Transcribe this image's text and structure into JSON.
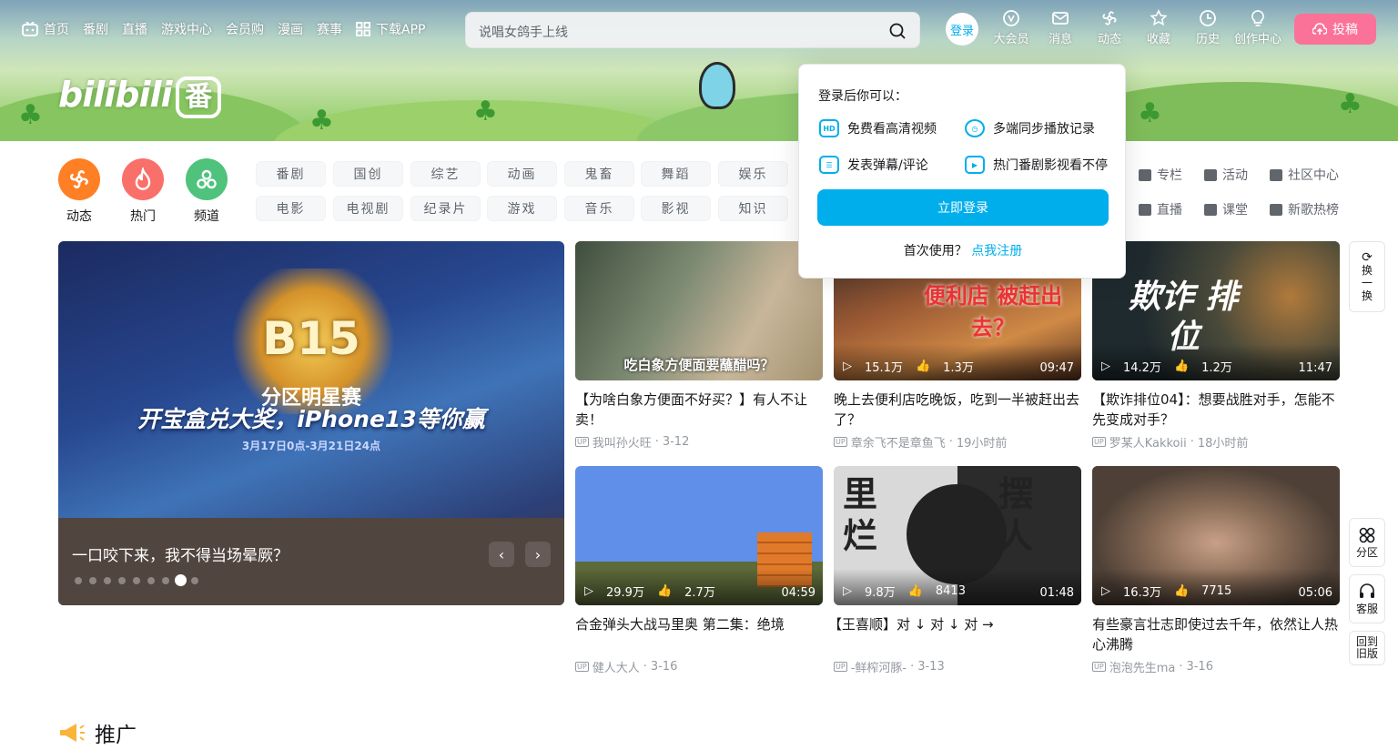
{
  "header": {
    "nav_left": [
      {
        "label": "首页",
        "icon": "tv-icon"
      },
      {
        "label": "番剧"
      },
      {
        "label": "直播"
      },
      {
        "label": "游戏中心"
      },
      {
        "label": "会员购"
      },
      {
        "label": "漫画"
      },
      {
        "label": "赛事"
      },
      {
        "label": "下载APP",
        "icon": "grid-icon"
      }
    ],
    "search_placeholder": "说唱女鸽手上线",
    "login_label": "登录",
    "nav_right": [
      {
        "label": "大会员",
        "icon": "vip-icon"
      },
      {
        "label": "消息",
        "icon": "mail-icon"
      },
      {
        "label": "动态",
        "icon": "wind-icon"
      },
      {
        "label": "收藏",
        "icon": "star-icon"
      },
      {
        "label": "历史",
        "icon": "clock-icon"
      },
      {
        "label": "创作中心",
        "icon": "bulb-icon"
      }
    ],
    "upload_label": "投稿",
    "logo_text": "bilibili",
    "logo_badge": "番"
  },
  "channels": {
    "circles": [
      {
        "label": "动态",
        "color": "#ff7f24"
      },
      {
        "label": "热门",
        "color": "#f9706b"
      },
      {
        "label": "频道",
        "color": "#4fc27c"
      }
    ],
    "row1": [
      "番剧",
      "国创",
      "综艺",
      "动画",
      "鬼畜",
      "舞蹈",
      "娱乐"
    ],
    "row2": [
      "电影",
      "电视剧",
      "纪录片",
      "游戏",
      "音乐",
      "影视",
      "知识"
    ],
    "right_links_row1": [
      "专栏",
      "活动",
      "社区中心"
    ],
    "right_links_row2": [
      "直播",
      "课堂",
      "新歌热榜"
    ]
  },
  "carousel": {
    "title": "一口咬下来，我不得当场晕厥？",
    "poster_badge": "B15",
    "poster_sub": "分区明星赛",
    "poster_headline": "开宝盒兑大奖，iPhone13等你赢",
    "poster_date": "3月17日0点-3月21日24点",
    "dots": 9,
    "active_dot": 7
  },
  "videos": [
    {
      "title": "【为啥白象方便面不好买？】有人不让卖！",
      "author": "我叫孙火旺",
      "date": "3-12",
      "plays": "",
      "likes": "",
      "duration": "",
      "caption": "吃白象方便面要蘸醋吗？",
      "bg": "#5b6e55"
    },
    {
      "title": "晚上去便利店吃晚饭，吃到一半被赶出去了？",
      "author": "章余飞不是章鱼飞",
      "date": "19小时前",
      "plays": "15.1万",
      "likes": "1.3万",
      "duration": "09:47",
      "caption": "便利店 被赶出去？",
      "bg": "#8a4b2b"
    },
    {
      "title": "【欺诈排位04】：想要战胜对手，怎能不先变成对手？",
      "author": "罗某人Kakkoii",
      "date": "18小时前",
      "plays": "14.2万",
      "likes": "1.2万",
      "duration": "11:47",
      "caption": "欺诈 排位",
      "bg": "#2d3a3e"
    },
    {
      "title": "合金弹头大战马里奥 第二集：绝境",
      "author": "健人大人",
      "date": "3-16",
      "plays": "29.9万",
      "likes": "2.7万",
      "duration": "04:59",
      "caption": "",
      "bg": "#5f8fe8"
    },
    {
      "title": "【王喜顺】对 ↓ 对 ↓ 对 →",
      "author": "-鲜榨河豚-",
      "date": "3-13",
      "plays": "9.8万",
      "likes": "8413",
      "duration": "01:48",
      "caption": "里 摆 烂 人",
      "bg": "#d9d9d9"
    },
    {
      "title": "有些豪言壮志即使过去千年，依然让人热心沸腾",
      "author": "泡泡先生ma",
      "date": "3-16",
      "plays": "16.3万",
      "likes": "7715",
      "duration": "05:06",
      "caption": "",
      "bg": "#6f5a48"
    }
  ],
  "login_popup": {
    "title": "登录后你可以：",
    "items": [
      {
        "label": "免费看高清视频",
        "icon": "hd-icon"
      },
      {
        "label": "多端同步播放记录",
        "icon": "clock-icon"
      },
      {
        "label": "发表弹幕/评论",
        "icon": "list-icon"
      },
      {
        "label": "热门番剧影视看不停",
        "icon": "play-icon"
      }
    ],
    "login_button": "立即登录",
    "first_use": "首次使用？",
    "register_link": "点我注册"
  },
  "side": {
    "refresh": "换一换",
    "zone": "分区",
    "service": "客服",
    "old_version": "回到旧版"
  },
  "section": {
    "title": "推广"
  }
}
